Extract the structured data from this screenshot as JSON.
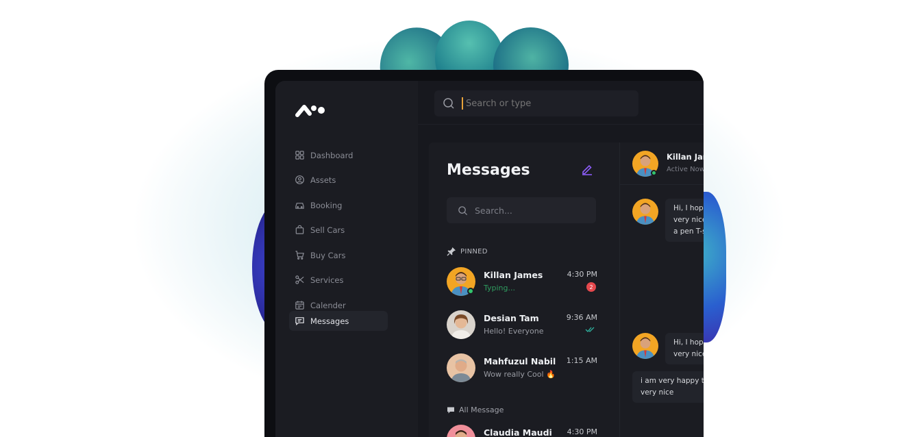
{
  "search": {
    "placeholder": "Search or type"
  },
  "sidebar": {
    "items": [
      {
        "label": "Dashboard",
        "icon": "grid-icon"
      },
      {
        "label": "Assets",
        "icon": "person-circle-icon"
      },
      {
        "label": "Booking",
        "icon": "car-icon"
      },
      {
        "label": "Sell Cars",
        "icon": "shopping-bag-icon"
      },
      {
        "label": "Buy Cars",
        "icon": "cart-icon"
      },
      {
        "label": "Services",
        "icon": "scissors-icon"
      },
      {
        "label": "Calender",
        "icon": "calendar-icon"
      },
      {
        "label": "Messages",
        "icon": "chat-icon",
        "active": true
      }
    ]
  },
  "messages": {
    "title": "Messages",
    "search_placeholder": "Search...",
    "pinned_label": "PINNED",
    "all_label": "All Message",
    "pinned": [
      {
        "name": "Killan James",
        "preview": "Typing...",
        "time": "4:30 PM",
        "unread": "2",
        "online": true,
        "typing": true
      },
      {
        "name": "Desian Tam",
        "preview": "Hello! Everyone",
        "time": "9:36 AM",
        "read": true
      },
      {
        "name": "Mahfuzul Nabil",
        "preview": "Wow really Cool 🔥",
        "time": "1:15 AM"
      }
    ],
    "all": [
      {
        "name": "Claudia Maudi",
        "time": "4:30 PM"
      }
    ]
  },
  "chat": {
    "name": "Killan James",
    "status": "Active Now",
    "messages": [
      {
        "lines": [
          "Hi, I hope you are doing",
          "very nice today. Send me",
          "a pen T-shirt"
        ]
      },
      {
        "lines": [
          "Hi, I hope you are doing",
          "very nice today"
        ]
      },
      {
        "lines": [
          "i am very happy today",
          "very nice"
        ],
        "own": true
      }
    ]
  },
  "colors": {
    "accent": "#e8a23a",
    "edit_icon": "#8b5cf6",
    "online": "#33c46d",
    "typing": "#2f9c5f",
    "badge": "#e5484d"
  }
}
